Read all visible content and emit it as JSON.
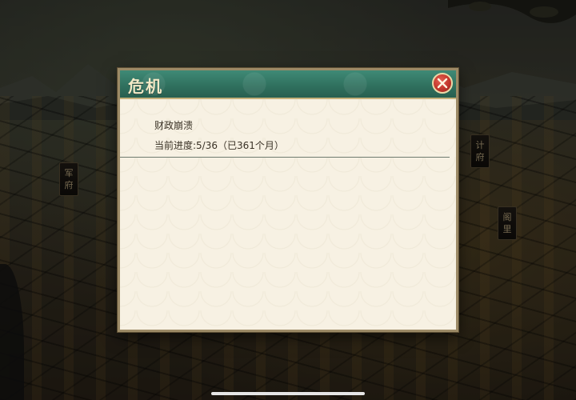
{
  "dialog": {
    "title": "危机",
    "close_icon": "close-icon",
    "crisis_name": "财政崩溃",
    "progress_label": "当前进度:",
    "progress_value": "5/36",
    "elapsed": "（已361个月）",
    "progress_text": "当前进度:5/36（已361个月）"
  },
  "map_labels": {
    "left": "军府",
    "right_top": "计府",
    "right_bottom": "阁里"
  },
  "colors": {
    "header_green": "#2f6f5d",
    "close_red": "#c2362b",
    "parchment": "#f7f1e3"
  }
}
